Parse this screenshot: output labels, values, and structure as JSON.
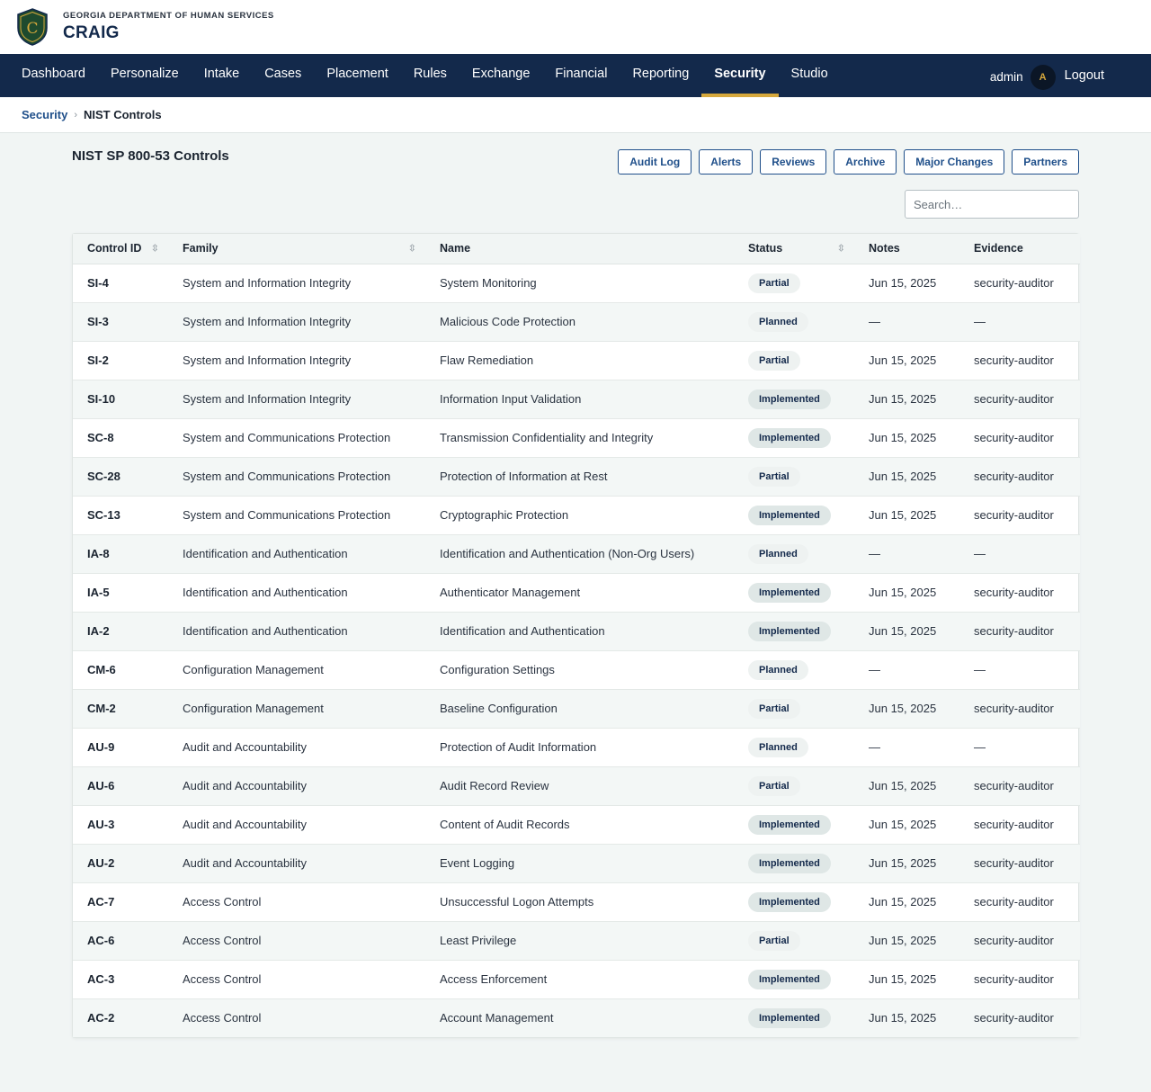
{
  "brand": {
    "agency": "GEORGIA DEPARTMENT OF HUMAN SERVICES",
    "app_name": "CRAIG",
    "logo_letter": "C",
    "colors": {
      "primary": "#13294b",
      "accent": "#d6a83c",
      "logo_green": "#1e4a2e"
    }
  },
  "nav": {
    "items": [
      {
        "label": "Dashboard"
      },
      {
        "label": "Personalize"
      },
      {
        "label": "Intake"
      },
      {
        "label": "Cases"
      },
      {
        "label": "Placement"
      },
      {
        "label": "Rules"
      },
      {
        "label": "Exchange"
      },
      {
        "label": "Financial"
      },
      {
        "label": "Reporting"
      },
      {
        "label": "Security",
        "active": true
      },
      {
        "label": "Studio"
      }
    ],
    "user": "admin",
    "avatar_initial": "A",
    "logout_label": "Logout"
  },
  "breadcrumb": {
    "parent": "Security",
    "separator": "›",
    "current": "NIST Controls"
  },
  "page": {
    "title": "NIST SP 800-53 Controls",
    "actions": [
      "Audit Log",
      "Alerts",
      "Reviews",
      "Archive",
      "Major Changes",
      "Partners"
    ],
    "search_placeholder": "Search…"
  },
  "table": {
    "columns": [
      {
        "label": "Control ID",
        "sortable": true
      },
      {
        "label": "Family",
        "sortable": true
      },
      {
        "label": "Name",
        "sortable": false
      },
      {
        "label": "Status",
        "sortable": true
      },
      {
        "label": "Notes",
        "sortable": false
      },
      {
        "label": "Evidence",
        "sortable": false
      }
    ],
    "sort_icon": "sort-icon",
    "rows": [
      {
        "id": "SI-4",
        "family": "System and Information Integrity",
        "name": "System Monitoring",
        "status": "Partial",
        "notes": "Jun 15, 2025",
        "evidence": "security-auditor"
      },
      {
        "id": "SI-3",
        "family": "System and Information Integrity",
        "name": "Malicious Code Protection",
        "status": "Planned",
        "notes": "—",
        "evidence": "—"
      },
      {
        "id": "SI-2",
        "family": "System and Information Integrity",
        "name": "Flaw Remediation",
        "status": "Partial",
        "notes": "Jun 15, 2025",
        "evidence": "security-auditor"
      },
      {
        "id": "SI-10",
        "family": "System and Information Integrity",
        "name": "Information Input Validation",
        "status": "Implemented",
        "notes": "Jun 15, 2025",
        "evidence": "security-auditor"
      },
      {
        "id": "SC-8",
        "family": "System and Communications Protection",
        "name": "Transmission Confidentiality and Integrity",
        "status": "Implemented",
        "notes": "Jun 15, 2025",
        "evidence": "security-auditor"
      },
      {
        "id": "SC-28",
        "family": "System and Communications Protection",
        "name": "Protection of Information at Rest",
        "status": "Partial",
        "notes": "Jun 15, 2025",
        "evidence": "security-auditor"
      },
      {
        "id": "SC-13",
        "family": "System and Communications Protection",
        "name": "Cryptographic Protection",
        "status": "Implemented",
        "notes": "Jun 15, 2025",
        "evidence": "security-auditor"
      },
      {
        "id": "IA-8",
        "family": "Identification and Authentication",
        "name": "Identification and Authentication (Non-Org Users)",
        "status": "Planned",
        "notes": "—",
        "evidence": "—"
      },
      {
        "id": "IA-5",
        "family": "Identification and Authentication",
        "name": "Authenticator Management",
        "status": "Implemented",
        "notes": "Jun 15, 2025",
        "evidence": "security-auditor"
      },
      {
        "id": "IA-2",
        "family": "Identification and Authentication",
        "name": "Identification and Authentication",
        "status": "Implemented",
        "notes": "Jun 15, 2025",
        "evidence": "security-auditor"
      },
      {
        "id": "CM-6",
        "family": "Configuration Management",
        "name": "Configuration Settings",
        "status": "Planned",
        "notes": "—",
        "evidence": "—"
      },
      {
        "id": "CM-2",
        "family": "Configuration Management",
        "name": "Baseline Configuration",
        "status": "Partial",
        "notes": "Jun 15, 2025",
        "evidence": "security-auditor"
      },
      {
        "id": "AU-9",
        "family": "Audit and Accountability",
        "name": "Protection of Audit Information",
        "status": "Planned",
        "notes": "—",
        "evidence": "—"
      },
      {
        "id": "AU-6",
        "family": "Audit and Accountability",
        "name": "Audit Record Review",
        "status": "Partial",
        "notes": "Jun 15, 2025",
        "evidence": "security-auditor"
      },
      {
        "id": "AU-3",
        "family": "Audit and Accountability",
        "name": "Content of Audit Records",
        "status": "Implemented",
        "notes": "Jun 15, 2025",
        "evidence": "security-auditor"
      },
      {
        "id": "AU-2",
        "family": "Audit and Accountability",
        "name": "Event Logging",
        "status": "Implemented",
        "notes": "Jun 15, 2025",
        "evidence": "security-auditor"
      },
      {
        "id": "AC-7",
        "family": "Access Control",
        "name": "Unsuccessful Logon Attempts",
        "status": "Implemented",
        "notes": "Jun 15, 2025",
        "evidence": "security-auditor"
      },
      {
        "id": "AC-6",
        "family": "Access Control",
        "name": "Least Privilege",
        "status": "Partial",
        "notes": "Jun 15, 2025",
        "evidence": "security-auditor"
      },
      {
        "id": "AC-3",
        "family": "Access Control",
        "name": "Access Enforcement",
        "status": "Implemented",
        "notes": "Jun 15, 2025",
        "evidence": "security-auditor"
      },
      {
        "id": "AC-2",
        "family": "Access Control",
        "name": "Account Management",
        "status": "Implemented",
        "notes": "Jun 15, 2025",
        "evidence": "security-auditor"
      }
    ]
  }
}
